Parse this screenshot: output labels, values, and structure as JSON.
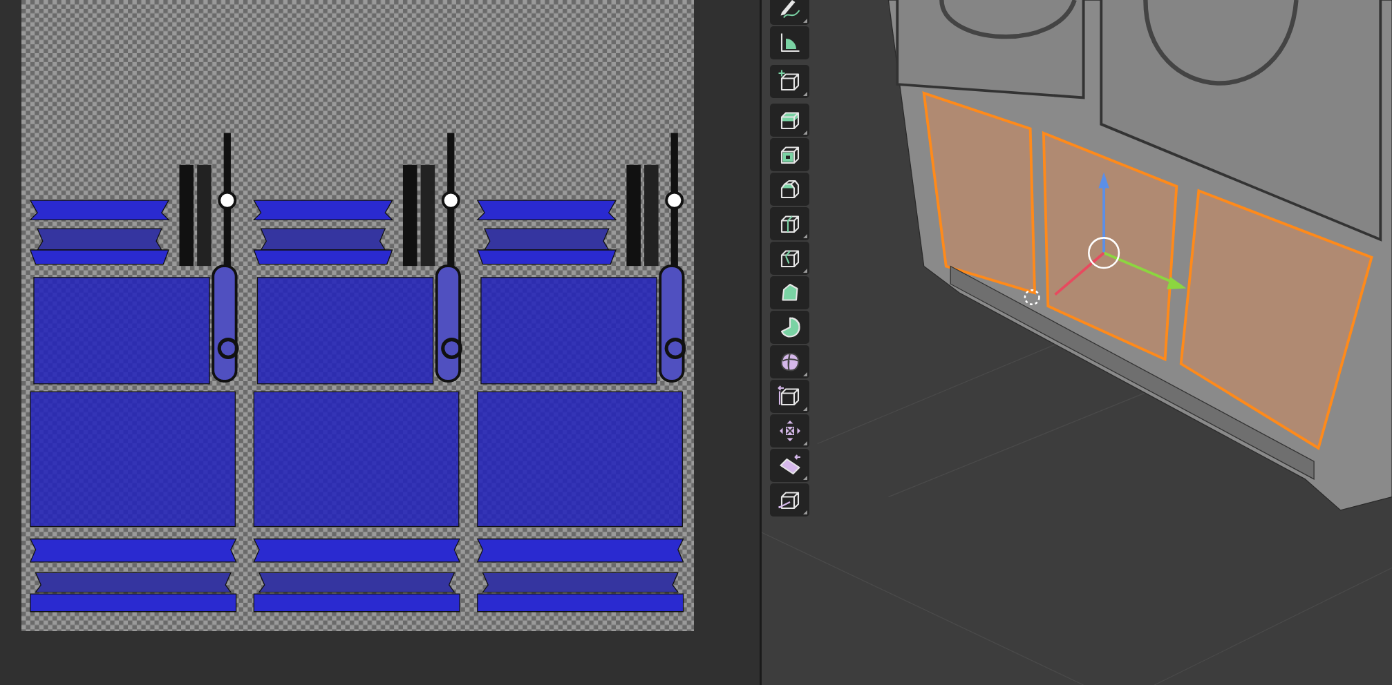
{
  "toolbar": {
    "groups": [
      {
        "tools": [
          {
            "kind": "annotate",
            "submenu": true
          },
          {
            "kind": "measure",
            "submenu": false
          }
        ]
      },
      {
        "tools": [
          {
            "kind": "add_cube",
            "submenu": true
          }
        ]
      },
      {
        "tools": [
          {
            "kind": "extrude",
            "submenu": true
          },
          {
            "kind": "inset",
            "submenu": false
          },
          {
            "kind": "bevel",
            "submenu": false
          },
          {
            "kind": "loop_cut",
            "submenu": true
          },
          {
            "kind": "knife",
            "submenu": true
          },
          {
            "kind": "poly_build",
            "submenu": false
          },
          {
            "kind": "spin",
            "submenu": false
          },
          {
            "kind": "smooth",
            "submenu": true
          },
          {
            "kind": "edge_slide",
            "submenu": true
          },
          {
            "kind": "shrink",
            "submenu": true
          },
          {
            "kind": "shear",
            "submenu": true
          },
          {
            "kind": "rip",
            "submenu": true
          }
        ]
      }
    ]
  }
}
